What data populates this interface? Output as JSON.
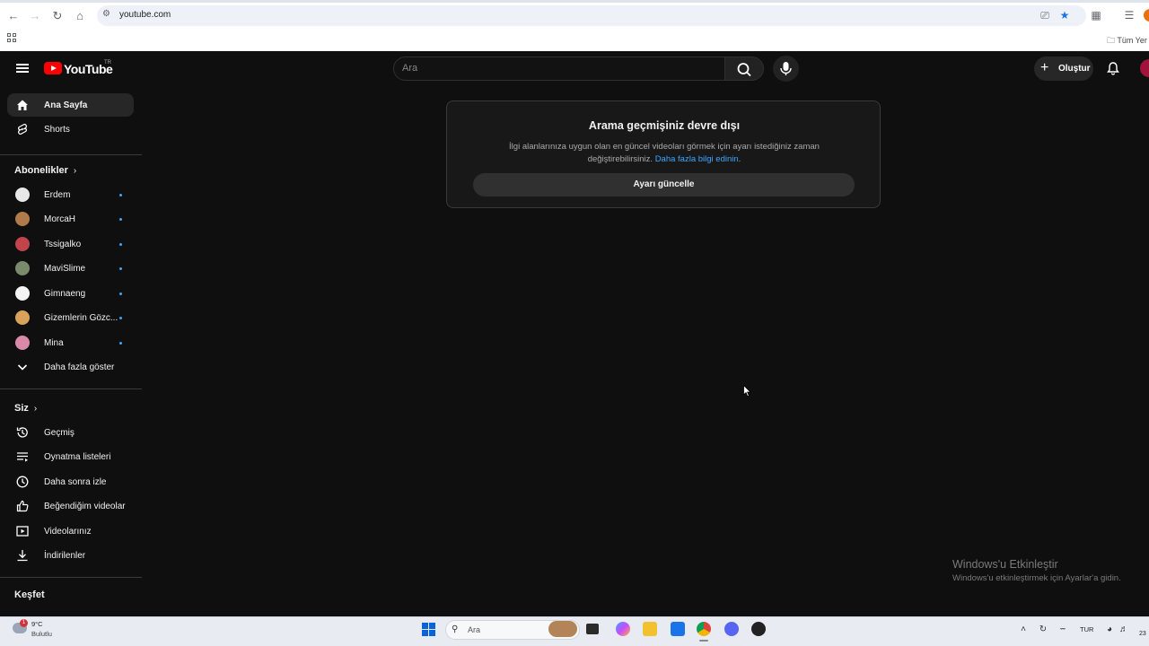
{
  "browser": {
    "url": "youtube.com",
    "bookmarks_folder_label": "Tüm Yer"
  },
  "header": {
    "logo_text": "YouTube",
    "country_code": "TR",
    "search_placeholder": "Ara",
    "create_label": "Oluştur"
  },
  "sidebar": {
    "main_items": [
      {
        "label": "Ana Sayfa",
        "icon": "home-icon",
        "active": true
      },
      {
        "label": "Shorts",
        "icon": "shorts-icon",
        "active": false
      }
    ],
    "subscriptions_heading": "Abonelikler",
    "subscriptions": [
      {
        "label": "Erdem",
        "color": "#e8e8e8"
      },
      {
        "label": "MorcaH",
        "color": "#b07a4a"
      },
      {
        "label": "Tssigalko",
        "color": "#c0444a"
      },
      {
        "label": "MaviSlime",
        "color": "#7a8a6a"
      },
      {
        "label": "Gimnaeng",
        "color": "#f4f4f4"
      },
      {
        "label": "Gizemlerin Gözc...",
        "color": "#d9a25a"
      },
      {
        "label": "Mina",
        "color": "#d98aa8"
      }
    ],
    "show_more_label": "Daha fazla göster",
    "you_heading": "Siz",
    "you_items": [
      {
        "label": "Geçmiş",
        "icon": "history-icon"
      },
      {
        "label": "Oynatma listeleri",
        "icon": "playlists-icon"
      },
      {
        "label": "Daha sonra izle",
        "icon": "watch-later-icon"
      },
      {
        "label": "Beğendiğim videolar",
        "icon": "liked-videos-icon"
      },
      {
        "label": "Videolarınız",
        "icon": "your-videos-icon"
      },
      {
        "label": "İndirilenler",
        "icon": "downloads-icon"
      }
    ],
    "explore_heading": "Keşfet"
  },
  "notice": {
    "title": "Arama geçmişiniz devre dışı",
    "text": "İlgi alanlarınıza uygun olan en güncel videoları görmek için ayarı istediğiniz zaman değiştirebilirsiniz.",
    "link": "Daha fazla bilgi edinin",
    "link_suffix": ".",
    "button_label": "Ayarı güncelle"
  },
  "watermark": {
    "title": "Windows'u Etkinleştir",
    "subtitle": "Windows'u etkinleştirmek için Ayarlar'a gidin."
  },
  "taskbar": {
    "weather_temp": "9°C",
    "weather_condition": "Bulutlu",
    "weather_badge": "1",
    "search_label": "Ara",
    "language": "TUR",
    "clock_partial": "23"
  }
}
